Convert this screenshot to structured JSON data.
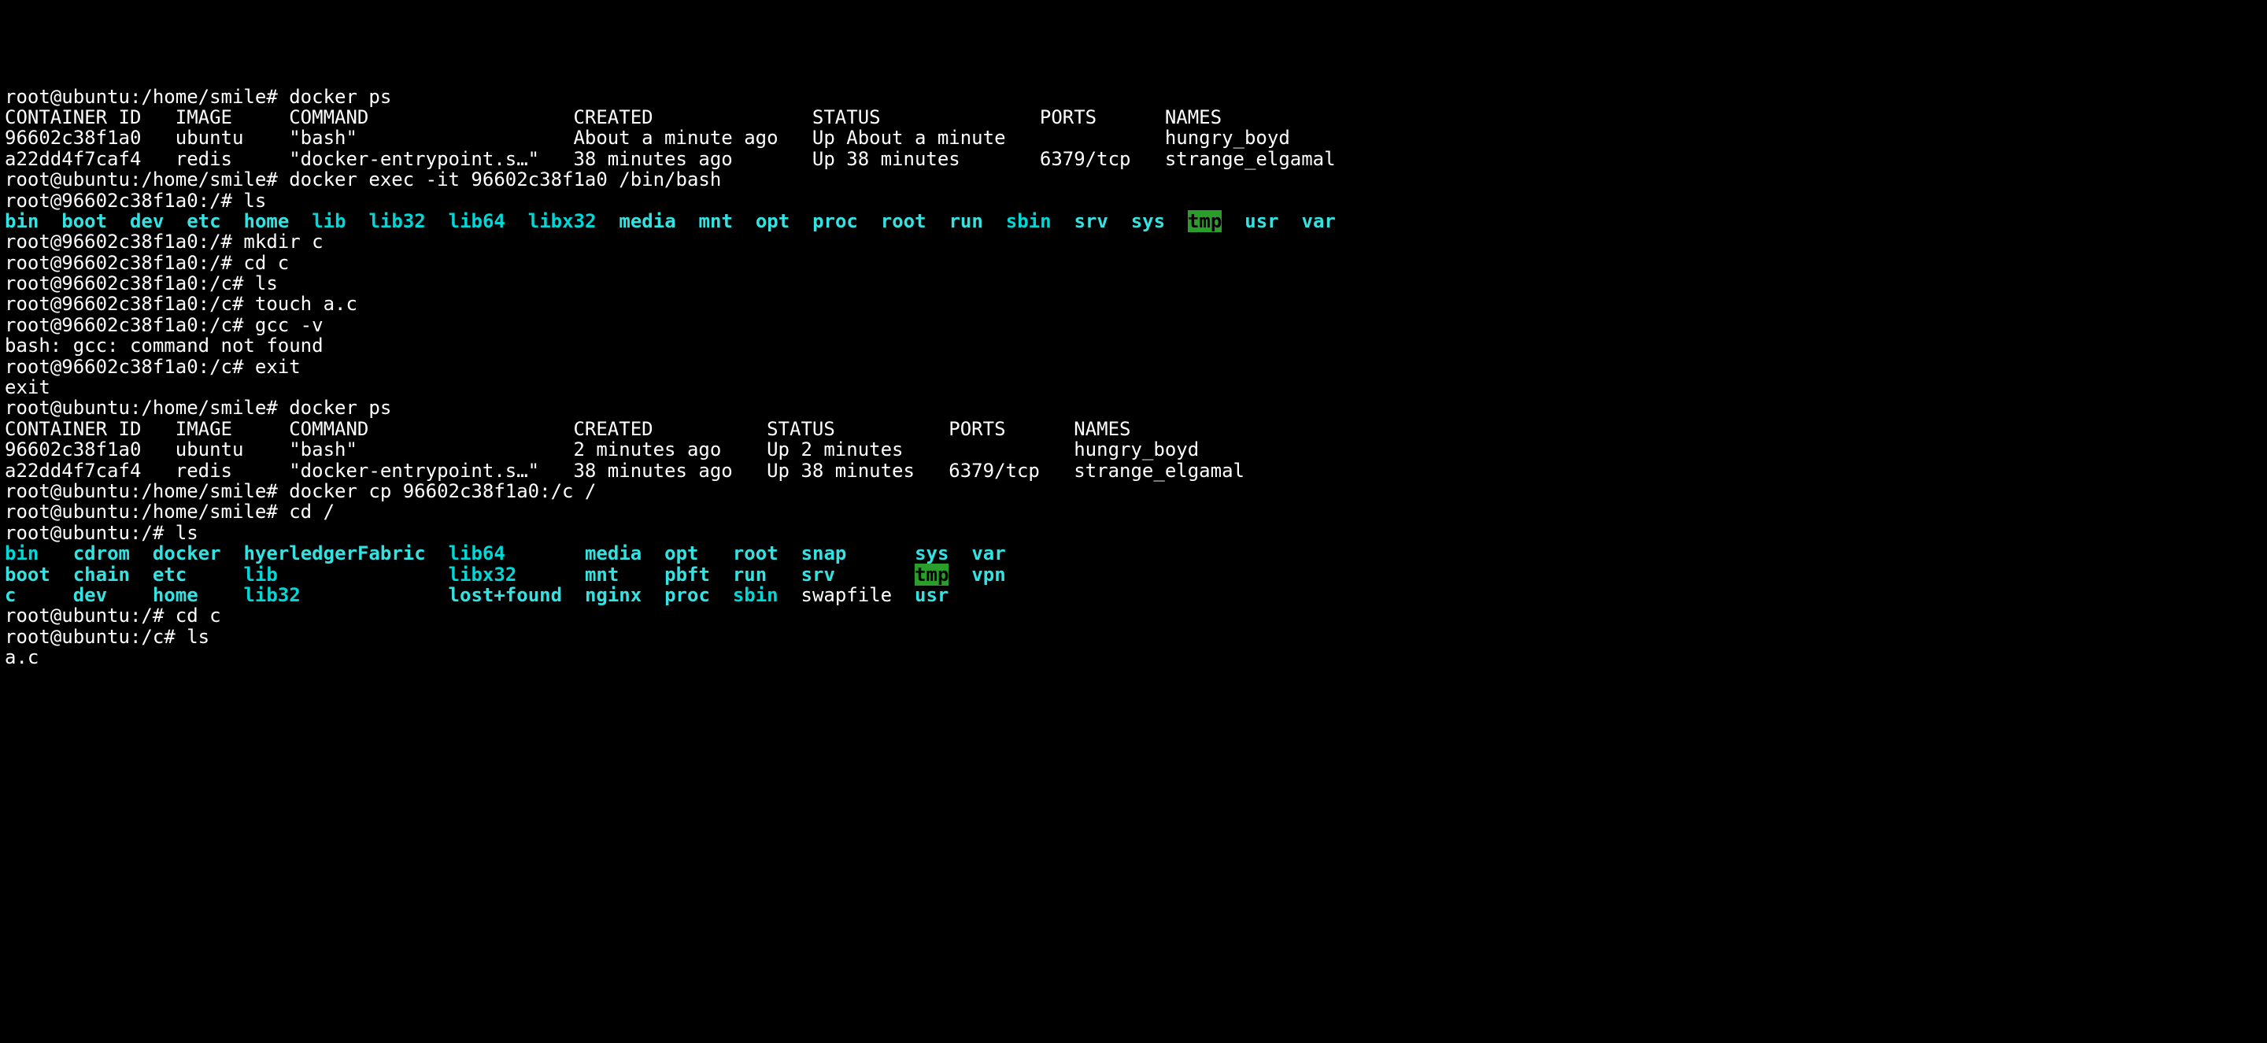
{
  "lines": [
    {
      "segments": [
        {
          "t": "root@ubuntu:/home/smile# docker ps"
        }
      ]
    },
    {
      "segments": [
        {
          "t": "CONTAINER ID   IMAGE     COMMAND                  CREATED              STATUS              PORTS      NAMES"
        }
      ]
    },
    {
      "segments": [
        {
          "t": "96602c38f1a0   ubuntu    \"bash\"                   About a minute ago   Up About a minute              hungry_boyd"
        }
      ]
    },
    {
      "segments": [
        {
          "t": "a22dd4f7caf4   redis     \"docker-entrypoint.s…\"   38 minutes ago       Up 38 minutes       6379/tcp   strange_elgamal"
        }
      ]
    },
    {
      "segments": [
        {
          "t": "root@ubuntu:/home/smile# docker exec -it 96602c38f1a0 /bin/bash"
        }
      ]
    },
    {
      "segments": [
        {
          "t": "root@96602c38f1a0:/# ls"
        }
      ]
    },
    {
      "segments": [
        {
          "t": "bin",
          "c": "cyan"
        },
        {
          "t": "  "
        },
        {
          "t": "boot",
          "c": "cyan"
        },
        {
          "t": "  "
        },
        {
          "t": "dev",
          "c": "cyan"
        },
        {
          "t": "  "
        },
        {
          "t": "etc",
          "c": "cyan"
        },
        {
          "t": "  "
        },
        {
          "t": "home",
          "c": "cyan"
        },
        {
          "t": "  "
        },
        {
          "t": "lib",
          "c": "cyanb"
        },
        {
          "t": "  "
        },
        {
          "t": "lib32",
          "c": "cyanb"
        },
        {
          "t": "  "
        },
        {
          "t": "lib64",
          "c": "cyanb"
        },
        {
          "t": "  "
        },
        {
          "t": "libx32",
          "c": "cyanb"
        },
        {
          "t": "  "
        },
        {
          "t": "media",
          "c": "cyan"
        },
        {
          "t": "  "
        },
        {
          "t": "mnt",
          "c": "cyan"
        },
        {
          "t": "  "
        },
        {
          "t": "opt",
          "c": "cyan"
        },
        {
          "t": "  "
        },
        {
          "t": "proc",
          "c": "cyan"
        },
        {
          "t": "  "
        },
        {
          "t": "root",
          "c": "cyan"
        },
        {
          "t": "  "
        },
        {
          "t": "run",
          "c": "cyan"
        },
        {
          "t": "  "
        },
        {
          "t": "sbin",
          "c": "cyanb"
        },
        {
          "t": "  "
        },
        {
          "t": "srv",
          "c": "cyan"
        },
        {
          "t": "  "
        },
        {
          "t": "sys",
          "c": "cyan"
        },
        {
          "t": "  "
        },
        {
          "t": "tmp",
          "c": "tmp"
        },
        {
          "t": "  "
        },
        {
          "t": "usr",
          "c": "cyan"
        },
        {
          "t": "  "
        },
        {
          "t": "var",
          "c": "cyan"
        }
      ]
    },
    {
      "segments": [
        {
          "t": "root@96602c38f1a0:/# mkdir c"
        }
      ]
    },
    {
      "segments": [
        {
          "t": "root@96602c38f1a0:/# cd c"
        }
      ]
    },
    {
      "segments": [
        {
          "t": "root@96602c38f1a0:/c# ls"
        }
      ]
    },
    {
      "segments": [
        {
          "t": "root@96602c38f1a0:/c# touch a.c"
        }
      ]
    },
    {
      "segments": [
        {
          "t": "root@96602c38f1a0:/c# gcc -v"
        }
      ]
    },
    {
      "segments": [
        {
          "t": "bash: gcc: command not found"
        }
      ]
    },
    {
      "segments": [
        {
          "t": "root@96602c38f1a0:/c# exit"
        }
      ]
    },
    {
      "segments": [
        {
          "t": "exit"
        }
      ]
    },
    {
      "segments": [
        {
          "t": "root@ubuntu:/home/smile# docker ps"
        }
      ]
    },
    {
      "segments": [
        {
          "t": "CONTAINER ID   IMAGE     COMMAND                  CREATED          STATUS          PORTS      NAMES"
        }
      ]
    },
    {
      "segments": [
        {
          "t": "96602c38f1a0   ubuntu    \"bash\"                   2 minutes ago    Up 2 minutes               hungry_boyd"
        }
      ]
    },
    {
      "segments": [
        {
          "t": "a22dd4f7caf4   redis     \"docker-entrypoint.s…\"   38 minutes ago   Up 38 minutes   6379/tcp   strange_elgamal"
        }
      ]
    },
    {
      "segments": [
        {
          "t": "root@ubuntu:/home/smile# docker cp 96602c38f1a0:/c /"
        }
      ]
    },
    {
      "segments": [
        {
          "t": "root@ubuntu:/home/smile# cd /"
        }
      ]
    },
    {
      "segments": [
        {
          "t": "root@ubuntu:/# ls"
        }
      ]
    },
    {
      "segments": [
        {
          "t": "bin",
          "c": "cyanb"
        },
        {
          "t": "   "
        },
        {
          "t": "cdrom",
          "c": "cyan"
        },
        {
          "t": "  "
        },
        {
          "t": "docker",
          "c": "cyan"
        },
        {
          "t": "  "
        },
        {
          "t": "hyerledgerFabric",
          "c": "cyan"
        },
        {
          "t": "  "
        },
        {
          "t": "lib64",
          "c": "cyanb"
        },
        {
          "t": "       "
        },
        {
          "t": "media",
          "c": "cyan"
        },
        {
          "t": "  "
        },
        {
          "t": "opt",
          "c": "cyan"
        },
        {
          "t": "   "
        },
        {
          "t": "root",
          "c": "cyan"
        },
        {
          "t": "  "
        },
        {
          "t": "snap",
          "c": "cyan"
        },
        {
          "t": "      "
        },
        {
          "t": "sys",
          "c": "cyan"
        },
        {
          "t": "  "
        },
        {
          "t": "var",
          "c": "cyan"
        }
      ]
    },
    {
      "segments": [
        {
          "t": "boot",
          "c": "cyan"
        },
        {
          "t": "  "
        },
        {
          "t": "chain",
          "c": "cyan"
        },
        {
          "t": "  "
        },
        {
          "t": "etc",
          "c": "cyan"
        },
        {
          "t": "     "
        },
        {
          "t": "lib",
          "c": "cyanb"
        },
        {
          "t": "               "
        },
        {
          "t": "libx32",
          "c": "cyanb"
        },
        {
          "t": "      "
        },
        {
          "t": "mnt",
          "c": "cyan"
        },
        {
          "t": "    "
        },
        {
          "t": "pbft",
          "c": "cyan"
        },
        {
          "t": "  "
        },
        {
          "t": "run",
          "c": "cyan"
        },
        {
          "t": "   "
        },
        {
          "t": "srv",
          "c": "cyan"
        },
        {
          "t": "       "
        },
        {
          "t": "tmp",
          "c": "tmp"
        },
        {
          "t": "  "
        },
        {
          "t": "vpn",
          "c": "cyan"
        }
      ]
    },
    {
      "segments": [
        {
          "t": "c",
          "c": "cyan"
        },
        {
          "t": "     "
        },
        {
          "t": "dev",
          "c": "cyan"
        },
        {
          "t": "    "
        },
        {
          "t": "home",
          "c": "cyan"
        },
        {
          "t": "    "
        },
        {
          "t": "lib32",
          "c": "cyanb"
        },
        {
          "t": "             "
        },
        {
          "t": "lost+found",
          "c": "cyan"
        },
        {
          "t": "  "
        },
        {
          "t": "nginx",
          "c": "cyan"
        },
        {
          "t": "  "
        },
        {
          "t": "proc",
          "c": "cyan"
        },
        {
          "t": "  "
        },
        {
          "t": "sbin",
          "c": "cyanb"
        },
        {
          "t": "  "
        },
        {
          "t": "swapfile"
        },
        {
          "t": "  "
        },
        {
          "t": "usr",
          "c": "cyan"
        }
      ]
    },
    {
      "segments": [
        {
          "t": "root@ubuntu:/# cd c"
        }
      ]
    },
    {
      "segments": [
        {
          "t": "root@ubuntu:/c# ls"
        }
      ]
    },
    {
      "segments": [
        {
          "t": "a.c"
        }
      ]
    }
  ]
}
